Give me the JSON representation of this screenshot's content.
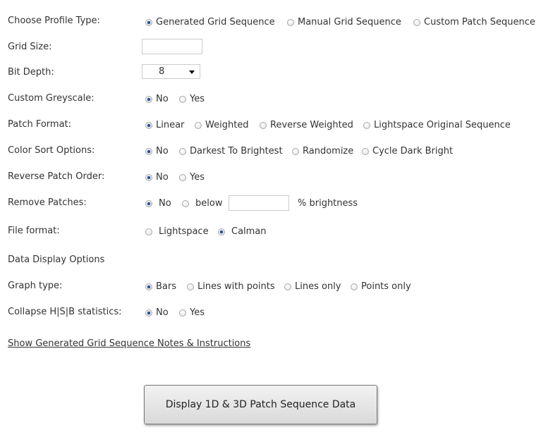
{
  "profile_type": {
    "label": "Choose Profile Type:",
    "options": [
      "Generated Grid Sequence",
      "Manual Grid Sequence",
      "Custom Patch Sequence"
    ],
    "selected": 0
  },
  "grid_size": {
    "label": "Grid Size:",
    "value": ""
  },
  "bit_depth": {
    "label": "Bit Depth:",
    "value": "8"
  },
  "custom_greyscale": {
    "label": "Custom Greyscale:",
    "options": [
      "No",
      "Yes"
    ],
    "selected": 0
  },
  "patch_format": {
    "label": "Patch Format:",
    "options": [
      "Linear",
      "Weighted",
      "Reverse Weighted",
      "Lightspace Original Sequence"
    ],
    "selected": 0
  },
  "color_sort": {
    "label": "Color Sort Options:",
    "options": [
      "No",
      "Darkest To Brightest",
      "Randomize",
      "Cycle Dark Bright"
    ],
    "selected": 0
  },
  "reverse_order": {
    "label": "Reverse Patch Order:",
    "options": [
      "No",
      "Yes"
    ],
    "selected": 0
  },
  "remove_patches": {
    "label": "Remove Patches:",
    "options": [
      "No",
      "below"
    ],
    "selected": 0,
    "value": "",
    "suffix": "% brightness"
  },
  "file_format": {
    "label": "File format:",
    "options": [
      "Lightspace",
      "Calman"
    ],
    "selected": 1
  },
  "data_display_heading": "Data Display Options",
  "graph_type": {
    "label": "Graph type:",
    "options": [
      "Bars",
      "Lines with points",
      "Lines only",
      "Points only"
    ],
    "selected": 0
  },
  "collapse_hsb": {
    "label": "Collapse H|S|B statistics:",
    "options": [
      "No",
      "Yes"
    ],
    "selected": 0
  },
  "notes_link": "Show Generated Grid Sequence Notes & Instructions",
  "submit_button": "Display 1D & 3D Patch Sequence Data"
}
